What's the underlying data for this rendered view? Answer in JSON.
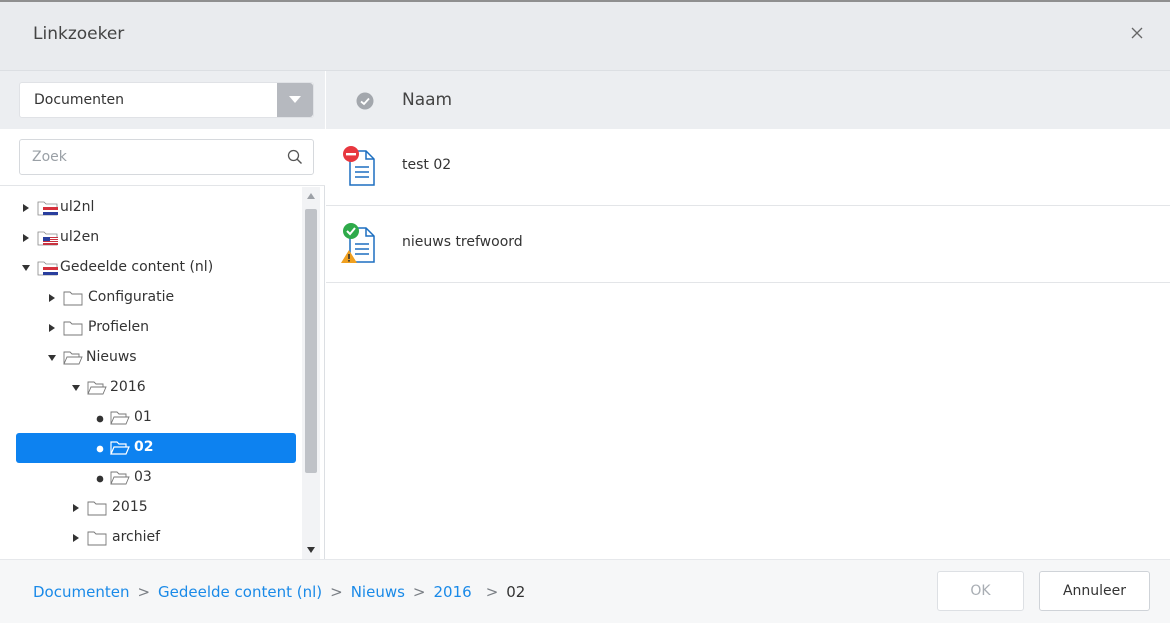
{
  "dialog": {
    "title": "Linkzoeker",
    "close_icon": "close-icon"
  },
  "left": {
    "source_select": {
      "value": "Documenten"
    },
    "search": {
      "placeholder": "Zoek",
      "value": ""
    },
    "tree": [
      {
        "label": "ul2nl",
        "state": "collapsed",
        "icon": "nl-flag-site-icon"
      },
      {
        "label": "ul2en",
        "state": "collapsed",
        "icon": "en-flag-site-icon"
      },
      {
        "label": "Gedeelde content (nl)",
        "state": "expanded",
        "icon": "nl-flag-site-icon"
      },
      {
        "label": "Configuratie",
        "state": "collapsed",
        "icon": "folder-icon"
      },
      {
        "label": "Profielen",
        "state": "collapsed",
        "icon": "folder-icon"
      },
      {
        "label": "Nieuws",
        "state": "expanded",
        "icon": "folder-open-icon"
      },
      {
        "label": "2016",
        "state": "expanded",
        "icon": "folder-open-icon"
      },
      {
        "label": "01",
        "state": "leaf",
        "icon": "folder-open-icon"
      },
      {
        "label": "02",
        "state": "leaf",
        "icon": "folder-open-icon",
        "selected": true
      },
      {
        "label": "03",
        "state": "leaf",
        "icon": "folder-open-icon"
      },
      {
        "label": "2015",
        "state": "collapsed",
        "icon": "folder-icon"
      },
      {
        "label": "archief",
        "state": "collapsed",
        "icon": "folder-icon"
      }
    ]
  },
  "right": {
    "column_header": "Naam",
    "items": [
      {
        "name": "test 02",
        "status": "blocked"
      },
      {
        "name": "nieuws trefwoord",
        "status": "published-warning"
      }
    ]
  },
  "footer": {
    "breadcrumb": [
      "Documenten",
      "Gedeelde content (nl)",
      "Nieuws",
      "2016"
    ],
    "breadcrumb_current": "02",
    "ok_label": "OK",
    "cancel_label": "Annuleer"
  },
  "colors": {
    "accent": "#0d82f0",
    "link": "#1a8ae8",
    "error": "#e8373f",
    "success": "#2eaa4a",
    "warning": "#f0a020"
  }
}
